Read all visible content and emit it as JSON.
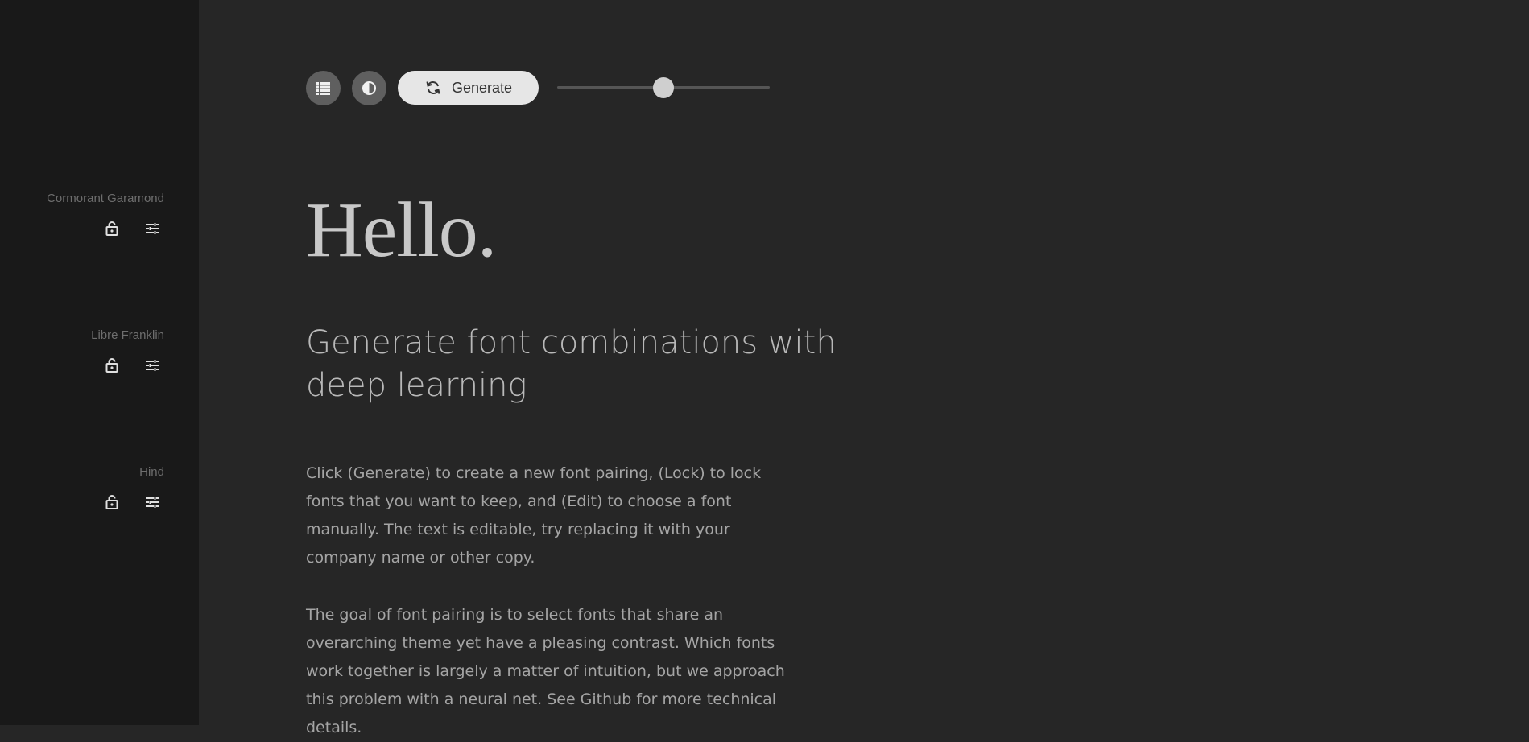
{
  "sidebar": {
    "fonts": [
      {
        "name": "Cormorant Garamond",
        "lock_icon": "lock-icon",
        "edit_icon": "tune-icon"
      },
      {
        "name": "Libre Franklin",
        "lock_icon": "lock-icon",
        "edit_icon": "tune-icon"
      },
      {
        "name": "Hind",
        "lock_icon": "lock-icon",
        "edit_icon": "tune-icon"
      }
    ]
  },
  "toolbar": {
    "list_icon": "list-icon",
    "contrast_icon": "contrast-icon",
    "generate_icon": "refresh-icon",
    "generate_label": "Generate",
    "slider_value": 0.5
  },
  "content": {
    "heading": "Hello.",
    "subheading": "Generate font combinations with deep learning",
    "paragraphs": [
      "Click (Generate) to create a new font pairing, (Lock) to lock fonts that you want to keep, and (Edit) to choose a font manually. The text is editable, try replacing it with your company name or other copy.",
      "The goal of font pairing is to select fonts that share an overarching theme yet have a pleasing contrast. Which fonts work together is largely a matter of intuition, but we approach this problem with a neural net. See Github for more technical details."
    ]
  },
  "colors": {
    "sidebar_bg": "#191919",
    "main_bg": "#262626",
    "button_bg": "#5f5f5f",
    "generate_bg": "#e6e6e6"
  }
}
